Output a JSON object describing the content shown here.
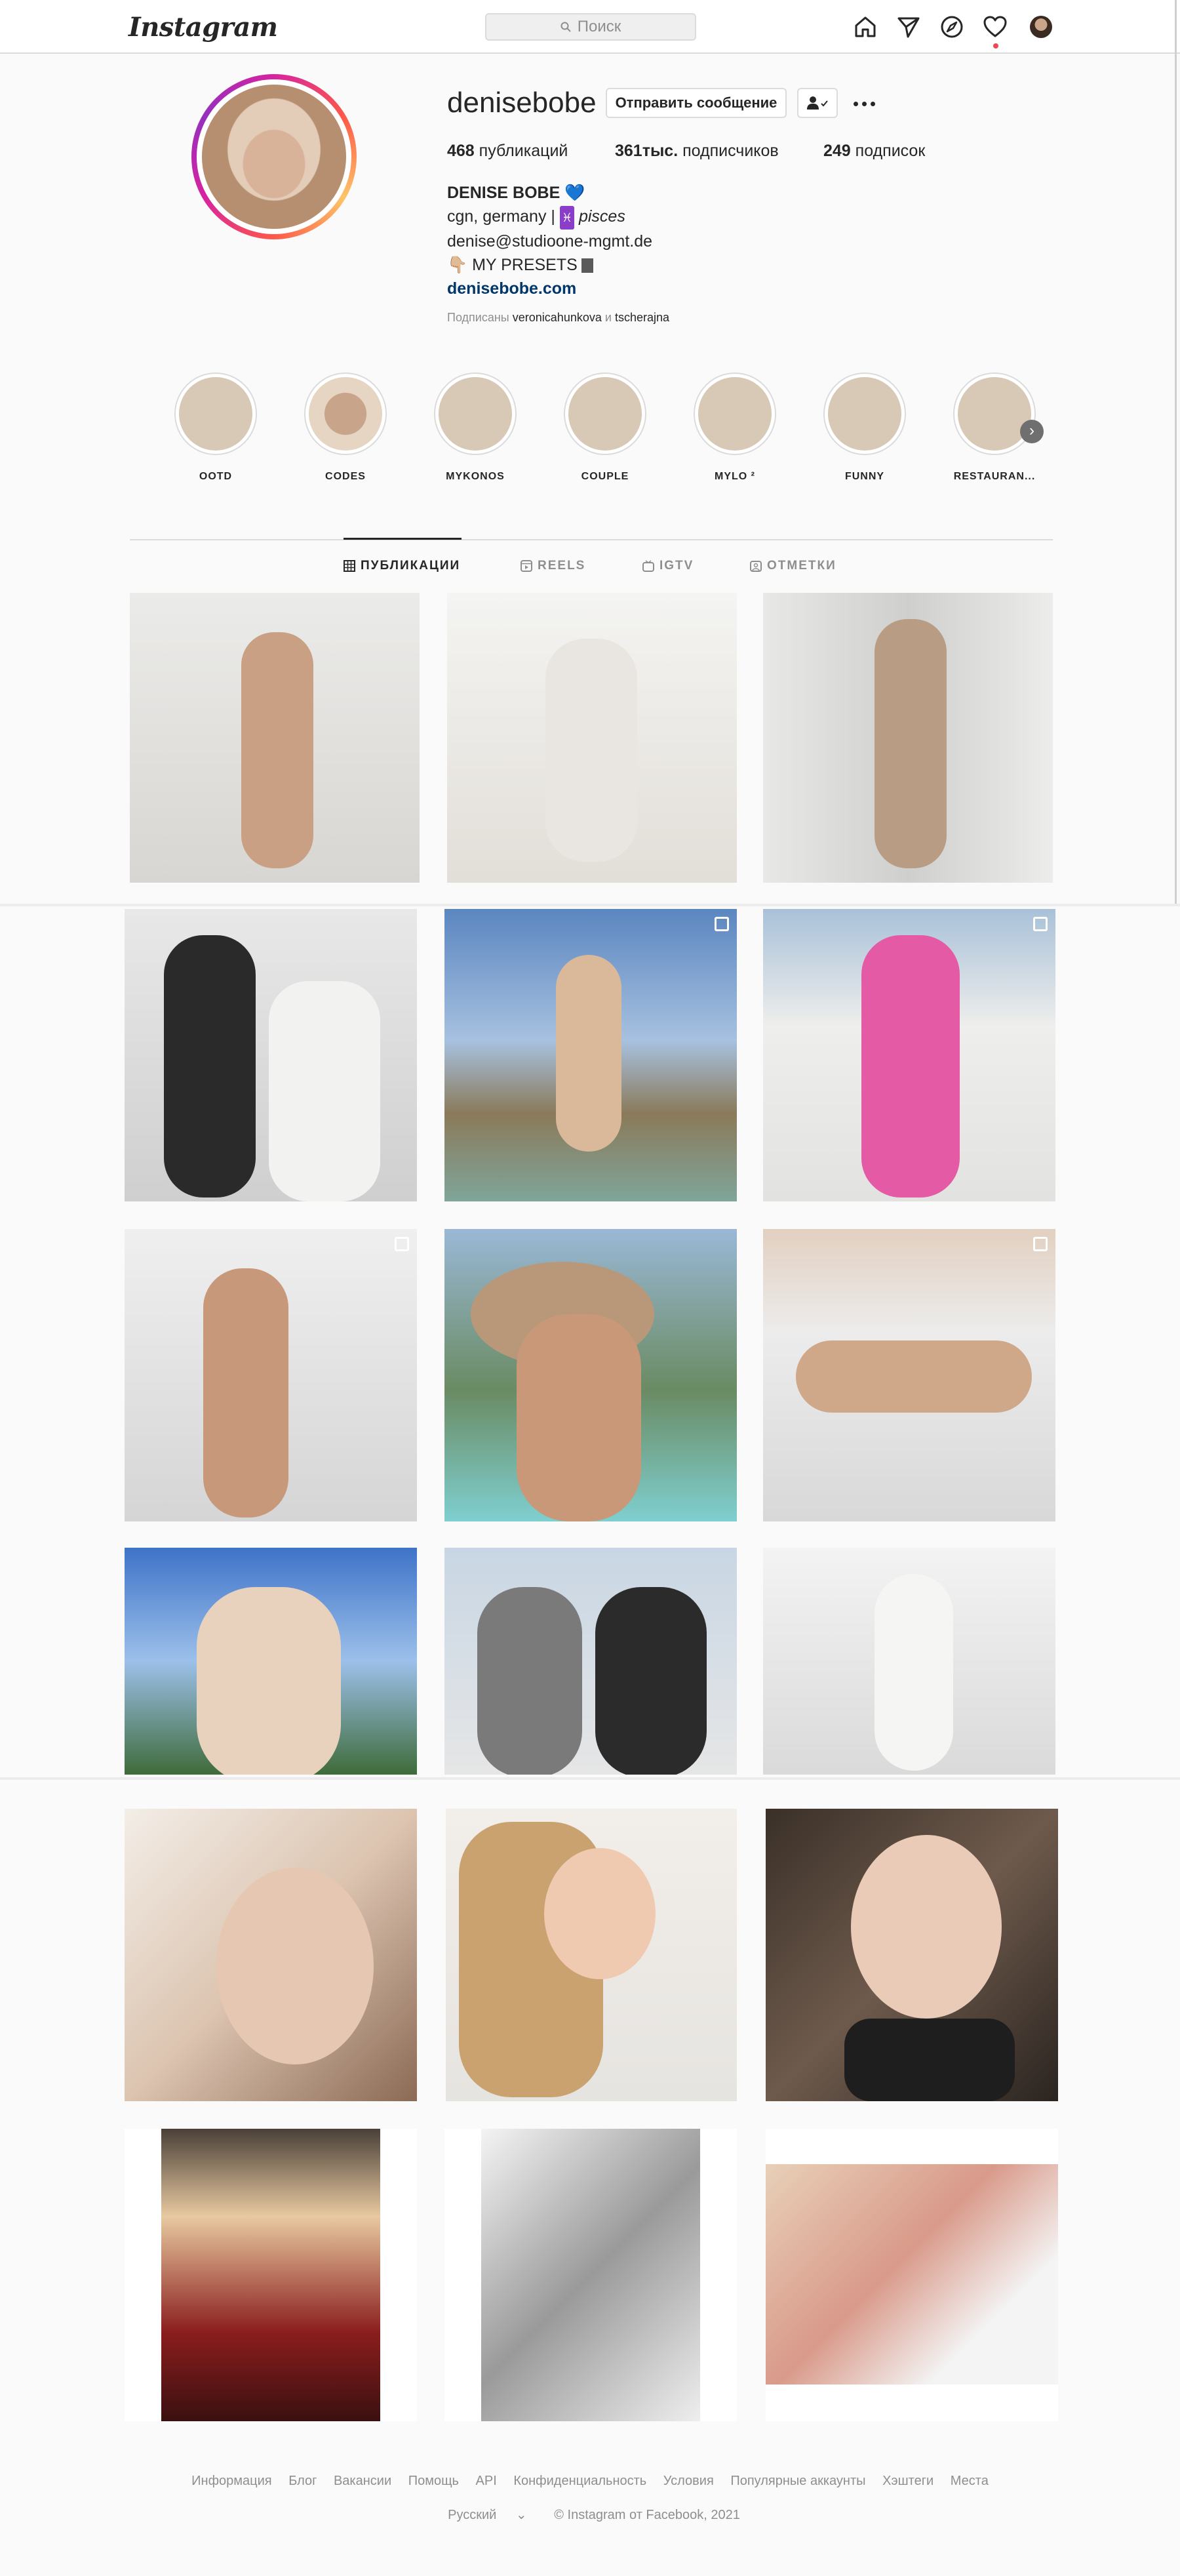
{
  "header": {
    "logo": "Instagram",
    "search_placeholder": "Поиск"
  },
  "profile": {
    "username": "denisebobe",
    "message_button": "Отправить сообщение",
    "stats": [
      {
        "value": "468",
        "label": "публикаций"
      },
      {
        "value": "361тыс.",
        "label": "подписчиков"
      },
      {
        "value": "249",
        "label": "подписок"
      }
    ],
    "bio": {
      "name": "DENISE BOBE",
      "name_emoji": "💙",
      "line1_pre": "cgn, germany |",
      "line1_sign": "♓",
      "line1_post": "pisces",
      "email": "denise@studioone-mgmt.de",
      "presets_emoji": "👇🏼",
      "presets": "MY PRESETS",
      "link": "denisebobe.com"
    },
    "followed_by": {
      "prefix": "Подписаны",
      "user1": "veronicahunkova",
      "conj": "и",
      "user2": "tscherajna"
    }
  },
  "highlights": [
    {
      "label": "OOTD"
    },
    {
      "label": "CODES"
    },
    {
      "label": "MYKONOS"
    },
    {
      "label": "COUPLE"
    },
    {
      "label": "MYLO ²"
    },
    {
      "label": "FUNNY"
    },
    {
      "label": "RESTAURAN..."
    }
  ],
  "tabs": [
    {
      "label": "ПУБЛИКАЦИИ",
      "icon": "grid-icon",
      "active": true
    },
    {
      "label": "REELS",
      "icon": "reels-icon",
      "active": false
    },
    {
      "label": "IGTV",
      "icon": "igtv-icon",
      "active": false
    },
    {
      "label": "ОТМЕТКИ",
      "icon": "tagged-icon",
      "active": false
    }
  ],
  "footer": {
    "links": [
      "Информация",
      "Блог",
      "Вакансии",
      "Помощь",
      "API",
      "Конфиденциальность",
      "Условия",
      "Популярные аккаунты",
      "Хэштеги",
      "Места"
    ],
    "language": "Русский",
    "language_chevron": "⌄",
    "copyright": "© Instagram от Facebook, 2021"
  },
  "colors": {
    "link": "#00376b",
    "notification_dot": "#ed4956",
    "border": "#dbdbdb",
    "secondary_text": "#8e8e8e"
  }
}
